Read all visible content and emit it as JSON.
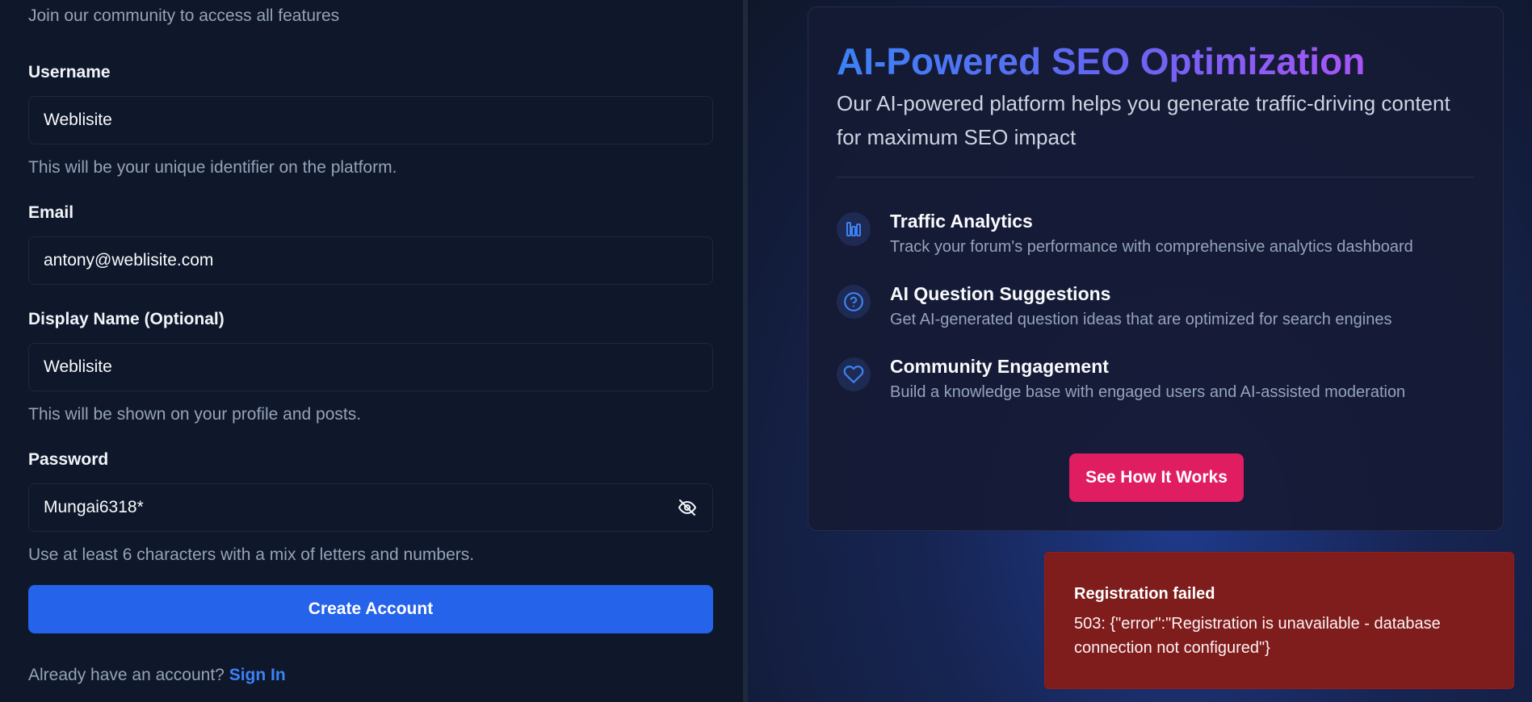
{
  "register": {
    "subtitle": "Join our community to access all features",
    "username": {
      "label": "Username",
      "value": "Weblisite",
      "helper": "This will be your unique identifier on the platform."
    },
    "email": {
      "label": "Email",
      "value": "antony@weblisite.com"
    },
    "display_name": {
      "label": "Display Name (Optional)",
      "value": "Weblisite",
      "helper": "This will be shown on your profile and posts."
    },
    "password": {
      "label": "Password",
      "value": "Mungai6318*",
      "helper": "Use at least 6 characters with a mix of letters and numbers.",
      "toggle_icon": "eye-off-icon"
    },
    "create_button": "Create Account",
    "signin_prompt": "Already have an account?",
    "signin_link": "Sign In"
  },
  "promo": {
    "title": "AI-Powered SEO Optimization",
    "description": "Our AI-powered platform helps you generate traffic-driving content for maximum SEO impact",
    "features": [
      {
        "icon": "bar-chart-icon",
        "title": "Traffic Analytics",
        "description": "Track your forum's performance with comprehensive analytics dashboard"
      },
      {
        "icon": "help-circle-icon",
        "title": "AI Question Suggestions",
        "description": "Get AI-generated question ideas that are optimized for search engines"
      },
      {
        "icon": "heart-icon",
        "title": "Community Engagement",
        "description": "Build a knowledge base with engaged users and AI-assisted moderation"
      }
    ],
    "cta_button": "See How It Works"
  },
  "toast": {
    "title": "Registration failed",
    "message": "503: {\"error\":\"Registration is unavailable - database connection not configured\"}"
  },
  "colors": {
    "primary": "#2563eb",
    "accent_pink": "#e11d62",
    "error_bg": "#7f1d1d",
    "panel_bg": "#0f172a"
  }
}
